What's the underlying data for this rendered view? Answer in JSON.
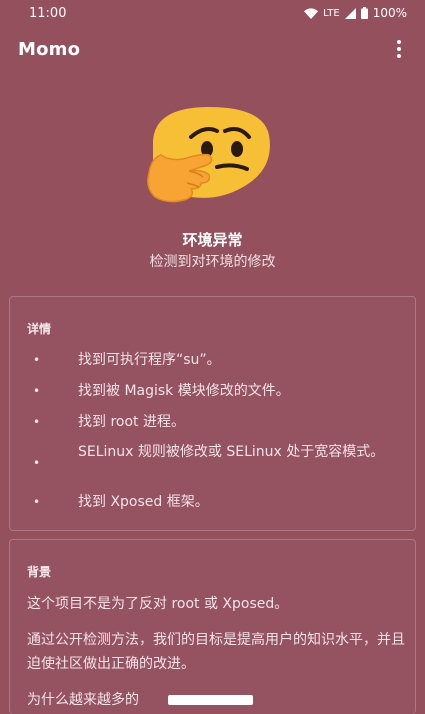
{
  "status_bar": {
    "time": "11:00",
    "network": "LTE",
    "battery": "100%"
  },
  "app_bar": {
    "title": "Momo"
  },
  "status": {
    "emoji_icon": "thinking-face-icon",
    "title": "环境异常",
    "subtitle": "检测到对环境的修改"
  },
  "details": {
    "title": "详情",
    "items": [
      "找到可执行程序“su”。",
      "找到被 Magisk 模块修改的文件。",
      "找到 root 进程。",
      "SELinux 规则被修改或 SELinux 处于宽容模式。",
      "找到 Xposed 框架。"
    ]
  },
  "background": {
    "title": "背景",
    "paragraphs": [
      "这个项目不是为了反对 root 或 Xposed。",
      "通过公开检测方法，我们的目标是提高用户的知识水平，并且迫使社区做出正确的改进。",
      "为什么越来越多的"
    ]
  },
  "colors": {
    "background": "#94505d",
    "card_border": "#ad7783",
    "emoji_yellow": "#f7bf36"
  }
}
